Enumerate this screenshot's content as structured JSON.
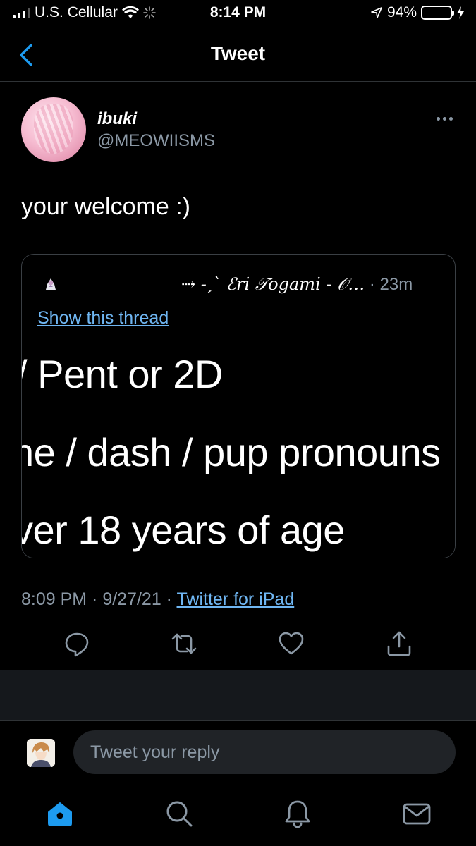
{
  "status_bar": {
    "carrier": "U.S. Cellular",
    "time": "8:14 PM",
    "battery": "94%",
    "battery_level": 0.94
  },
  "nav": {
    "title": "Tweet"
  },
  "tweet": {
    "display_name": "ibuki",
    "handle": "@MEOWIISMS",
    "text": "your welcome :)",
    "timestamp": "8:09 PM · 9/27/21 · ",
    "source": "Twitter for iPad"
  },
  "quoted_tweet": {
    "name": "⇢ -ˏˋ ℰri 𝒯ogami - 𝒪…",
    "time": " · 23m",
    "show_thread": "Show this thread",
    "image_lines": [
      "/ Pent or 2D",
      "ne / dash / pup pronouns",
      "ver 18 years of age"
    ]
  },
  "composer": {
    "placeholder": "Tweet your reply"
  },
  "icons": {
    "back": "chevron-left-icon",
    "more": "more-horizontal-icon",
    "reply": "comment-icon",
    "retweet": "retweet-icon",
    "like": "heart-icon",
    "share": "share-icon",
    "home": "home-icon",
    "search": "search-icon",
    "notifications": "bell-icon",
    "messages": "mail-icon"
  },
  "colors": {
    "accent": "#1d9bf0",
    "link": "#6fb6f2",
    "muted": "#8b98a5",
    "battery": "#34c759"
  }
}
